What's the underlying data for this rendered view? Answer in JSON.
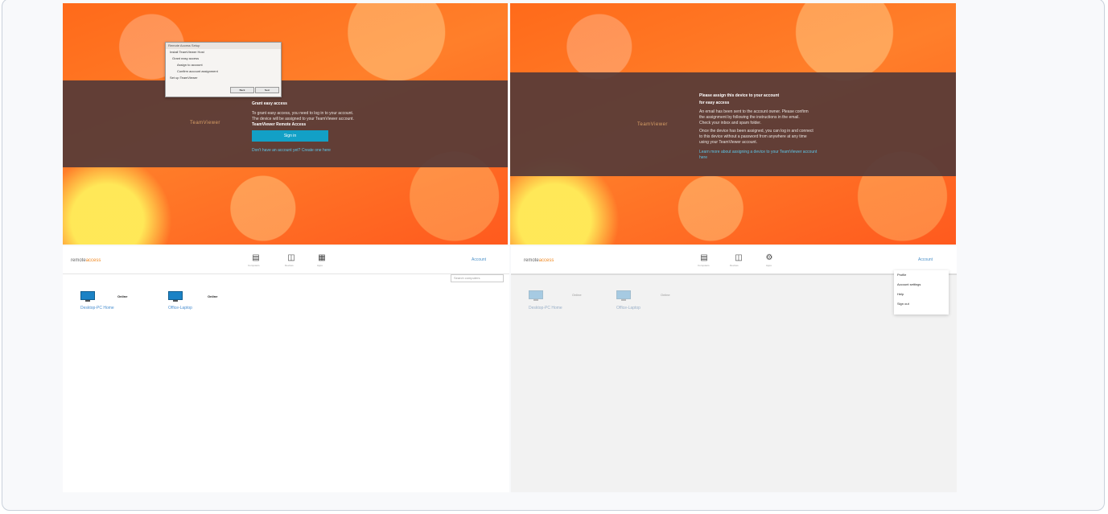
{
  "left_top": {
    "dialog_title": "Remote Access Setup",
    "dialog_lines": [
      "Install TeamViewer Host",
      "Grant easy access",
      "Assign to account",
      "Confirm account assignment",
      "Set up TeamViewer"
    ],
    "dialog_buttons": [
      "Back",
      "Next"
    ],
    "brand": "TeamViewer",
    "heading": "Grant easy access",
    "body_lines": [
      "To grant easy access, you need to log in to your account.",
      "The device will be assigned to your TeamViewer account.",
      "TeamViewer Remote Access"
    ],
    "primary_button": "Sign in",
    "footer_link": "Don't have an account yet? Create one here"
  },
  "right_top": {
    "brand": "TeamViewer",
    "heading_lines": [
      "Please assign this device to your account",
      "for easy access"
    ],
    "body_lines": [
      "An email has been sent to the account owner. Please confirm",
      "the assignment by following the instructions in the email.",
      "Check your inbox and spam folder.",
      "Once the device has been assigned, you can log in and connect",
      "to this device without a password from anywhere at any time",
      "using your TeamViewer account."
    ],
    "link_lines": [
      "Learn more about assigning a device to your TeamViewer account",
      "here"
    ]
  },
  "left_bottom": {
    "brand_prefix": "remote",
    "brand_accent": "access",
    "nav": [
      "Computers",
      "Devices",
      "Apps"
    ],
    "user_button": "Account",
    "search_placeholder": "Search computers",
    "computers": [
      {
        "name": "Desktop-PC Home",
        "status": "Online"
      },
      {
        "name": "Office-Laptop",
        "status": "Online"
      }
    ]
  },
  "right_bottom": {
    "brand_prefix": "remote",
    "brand_accent": "access",
    "nav": [
      "Computers",
      "Devices",
      "Apps"
    ],
    "user_button": "Account",
    "computers": [
      {
        "name": "Desktop-PC Home",
        "status": "Online"
      },
      {
        "name": "Office-Laptop",
        "status": "Online"
      }
    ],
    "menu_items": [
      "Profile",
      "Account settings",
      "Help",
      "Sign out"
    ]
  }
}
